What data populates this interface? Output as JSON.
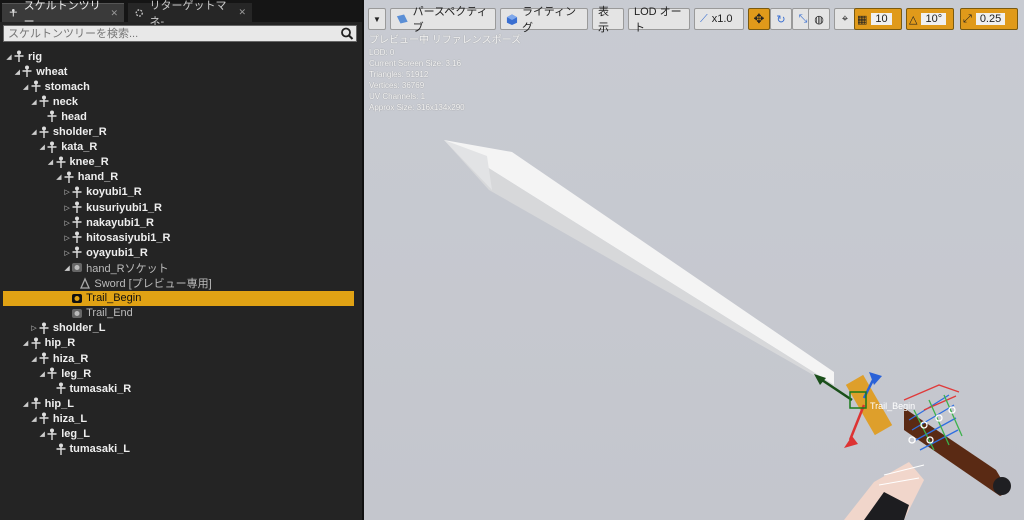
{
  "tabs": [
    {
      "label": "スケルトンツリー",
      "icon": "skeleton-icon"
    },
    {
      "label": "リターゲットマネ-",
      "icon": "retarget-icon"
    }
  ],
  "search": {
    "placeholder": "スケルトンツリーを検索..."
  },
  "tree": [
    {
      "label": "rig",
      "bold": true,
      "indent": 0,
      "expanded": true
    },
    {
      "label": "wheat",
      "bold": true,
      "indent": 1,
      "expanded": true
    },
    {
      "label": "stomach",
      "bold": true,
      "indent": 2,
      "expanded": true
    },
    {
      "label": "neck",
      "bold": true,
      "indent": 3,
      "expanded": true
    },
    {
      "label": "head",
      "bold": true,
      "indent": 4,
      "expanded": null
    },
    {
      "label": "sholder_R",
      "bold": true,
      "indent": 3,
      "expanded": true
    },
    {
      "label": "kata_R",
      "bold": true,
      "indent": 4,
      "expanded": true
    },
    {
      "label": "knee_R",
      "bold": true,
      "indent": 5,
      "expanded": true
    },
    {
      "label": "hand_R",
      "bold": true,
      "indent": 6,
      "expanded": true
    },
    {
      "label": "koyubi1_R",
      "bold": true,
      "indent": 7,
      "expanded": false
    },
    {
      "label": "kusuriyubi1_R",
      "bold": true,
      "indent": 7,
      "expanded": false
    },
    {
      "label": "nakayubi1_R",
      "bold": true,
      "indent": 7,
      "expanded": false
    },
    {
      "label": "hitosasiyubi1_R",
      "bold": true,
      "indent": 7,
      "expanded": false
    },
    {
      "label": "oyayubi1_R",
      "bold": true,
      "indent": 7,
      "expanded": false
    },
    {
      "label": "hand_Rソケット",
      "bold": false,
      "indent": 7,
      "expanded": true,
      "type": "socket"
    },
    {
      "label": "Sword [プレビュー専用]",
      "bold": false,
      "indent": 8,
      "expanded": null,
      "type": "mesh"
    },
    {
      "label": "Trail_Begin",
      "bold": false,
      "indent": 7,
      "expanded": null,
      "type": "socket",
      "selected": true
    },
    {
      "label": "Trail_End",
      "bold": false,
      "indent": 7,
      "expanded": null,
      "type": "socket"
    },
    {
      "label": "sholder_L",
      "bold": true,
      "indent": 3,
      "expanded": false
    },
    {
      "label": "hip_R",
      "bold": true,
      "indent": 2,
      "expanded": true
    },
    {
      "label": "hiza_R",
      "bold": true,
      "indent": 3,
      "expanded": true
    },
    {
      "label": "leg_R",
      "bold": true,
      "indent": 4,
      "expanded": true
    },
    {
      "label": "tumasaki_R",
      "bold": true,
      "indent": 5,
      "expanded": null
    },
    {
      "label": "hip_L",
      "bold": true,
      "indent": 2,
      "expanded": true
    },
    {
      "label": "hiza_L",
      "bold": true,
      "indent": 3,
      "expanded": true
    },
    {
      "label": "leg_L",
      "bold": true,
      "indent": 4,
      "expanded": true
    },
    {
      "label": "tumasaki_L",
      "bold": true,
      "indent": 5,
      "expanded": null
    }
  ],
  "toolbar": {
    "perspective": "パースペクティブ",
    "lighting": "ライティング",
    "show": "表示",
    "lod": "LOD オート",
    "speed": "x1.0",
    "grid_snap": "10",
    "rot_snap": "10°",
    "scale_snap": "0.25"
  },
  "overlay": {
    "title": "プレビュー中 リファレンスポーズ",
    "lines": [
      "LOD: 0",
      "Current Screen Size: 3.16",
      "Triangles: 51912",
      "Vertices: 36769",
      "UV Channels: 1",
      "Approx Size: 316x134x290"
    ],
    "socket_label": "Trail_Begin"
  },
  "colors": {
    "selection": "#e0a214",
    "orange_button": "#e09a1a",
    "viewport_bg": "#c6c8cf"
  }
}
